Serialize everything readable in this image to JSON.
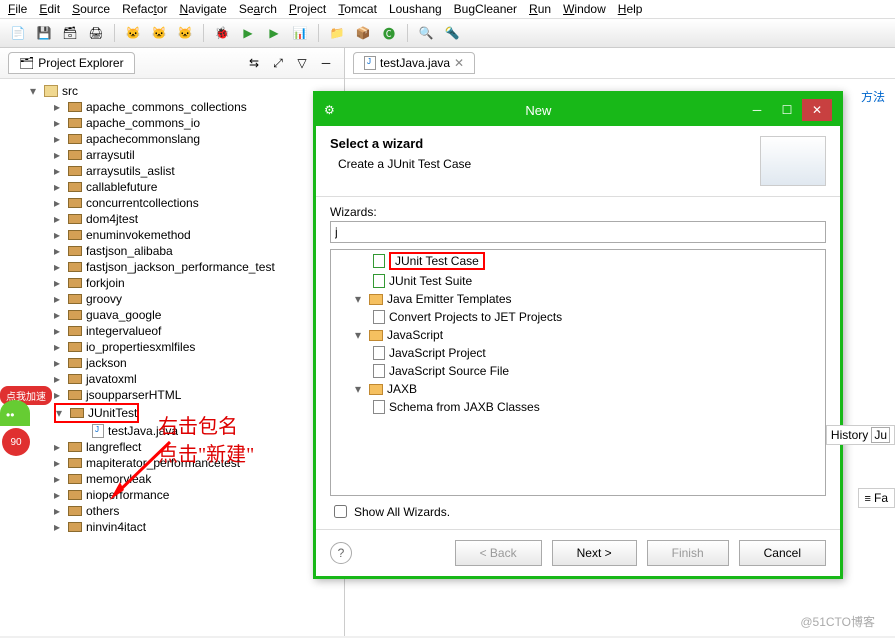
{
  "menu": [
    "File",
    "Edit",
    "Source",
    "Refactor",
    "Navigate",
    "Search",
    "Project",
    "Tomcat",
    "Loushang",
    "BugCleaner",
    "Run",
    "Window",
    "Help"
  ],
  "explorer": {
    "title": "Project Explorer",
    "src": "src",
    "packages": [
      "apache_commons_collections",
      "apache_commons_io",
      "apachecommonslang",
      "arraysutil",
      "arraysutils_aslist",
      "callablefuture",
      "concurrentcollections",
      "dom4jtest",
      "enuminvokemethod",
      "fastjson_alibaba",
      "fastjson_jackson_performance_test",
      "forkjoin",
      "groovy",
      "guava_google",
      "integervalueof",
      "io_propertiesxmlfiles",
      "jackson",
      "javatoxml",
      "jsoupparserHTML"
    ],
    "junit_pkg": "JUnitTest",
    "junit_file": "testJava.java",
    "packages2": [
      "langreflect",
      "mapiterator_performancetest",
      "memoryleak",
      "nioperformance",
      "others",
      "ninvin4itact"
    ]
  },
  "editor": {
    "tab": "testJava.java"
  },
  "dialog": {
    "title": "New",
    "header_title": "Select a wizard",
    "header_sub": "Create a JUnit Test Case",
    "wizards_label": "Wizards:",
    "filter": "j",
    "items": {
      "junit_case": "JUnit Test Case",
      "junit_suite": "JUnit Test Suite",
      "jet": "Java Emitter Templates",
      "jet_sub": "Convert Projects to JET Projects",
      "js": "JavaScript",
      "js_proj": "JavaScript Project",
      "js_src": "JavaScript Source File",
      "jaxb": "JAXB",
      "jaxb_sub": "Schema from JAXB Classes"
    },
    "show_all": "Show All Wizards.",
    "btn_back": "< Back",
    "btn_next": "Next >",
    "btn_finish": "Finish",
    "btn_cancel": "Cancel"
  },
  "annotation": {
    "line1": "右击包名",
    "line2": "点击\"新建\""
  },
  "side": {
    "history": "History",
    "ju": "Ju",
    "fa": "Fa"
  },
  "mascot": "点我加速",
  "mascot_num": "90",
  "watermark": "@51CTO博客",
  "blue_text": "方法"
}
